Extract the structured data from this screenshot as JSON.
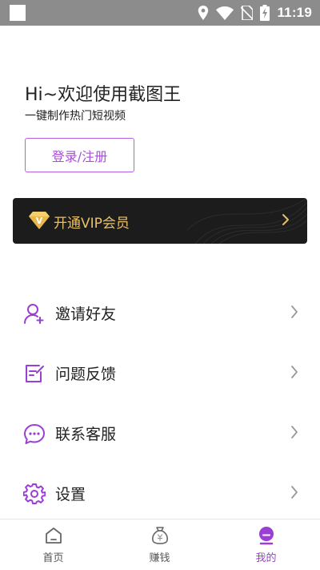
{
  "status_bar": {
    "time": "11:19",
    "icons": [
      "location-icon",
      "wifi-icon",
      "no-sim-icon",
      "battery-charging-icon"
    ]
  },
  "profile": {
    "greeting": "Hi~欢迎使用截图王",
    "subtitle": "一键制作热门短视频",
    "login_label": "登录/注册"
  },
  "vip": {
    "badge_letter": "V",
    "label": "开通VIP会员"
  },
  "menu": {
    "items": [
      {
        "label": "邀请好友",
        "icon": "invite-friend-icon"
      },
      {
        "label": "问题反馈",
        "icon": "feedback-icon"
      },
      {
        "label": "联系客服",
        "icon": "customer-service-icon"
      },
      {
        "label": "设置",
        "icon": "settings-gear-icon"
      }
    ]
  },
  "tabbar": {
    "tabs": [
      {
        "label": "首页",
        "icon": "home-icon",
        "active": false
      },
      {
        "label": "赚钱",
        "icon": "money-bag-icon",
        "active": false
      },
      {
        "label": "我的",
        "icon": "profile-icon",
        "active": true
      }
    ]
  },
  "colors": {
    "accent": "#a94fd6",
    "vip_gold": "#e8c06c",
    "vip_bg": "#1c1c1c",
    "status_bar": "#8c8c8c"
  }
}
